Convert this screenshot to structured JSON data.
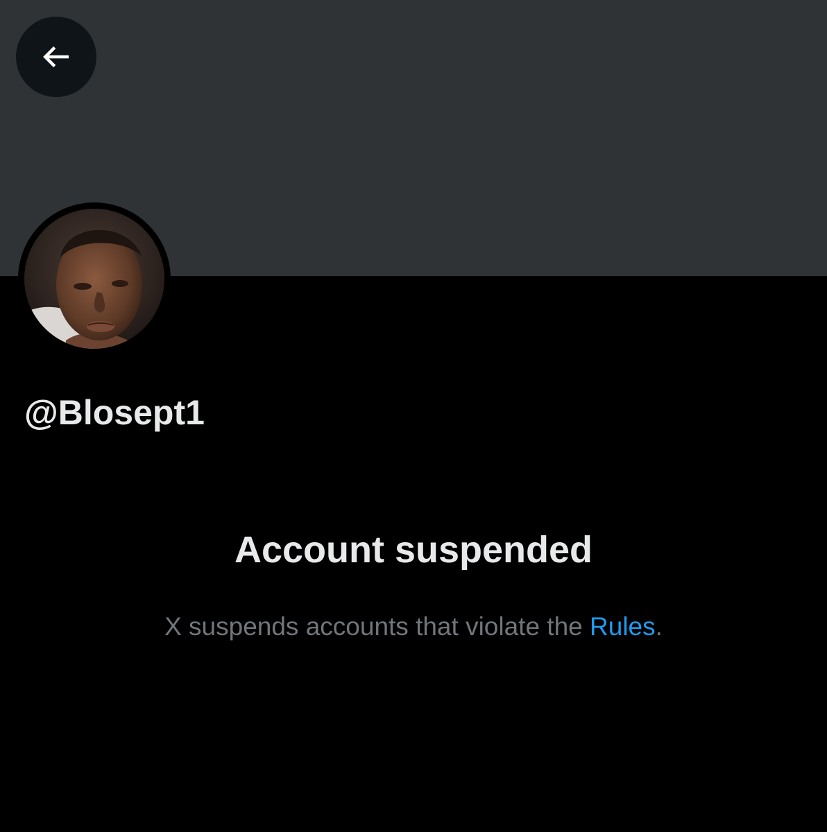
{
  "profile": {
    "handle": "@Blosept1",
    "avatar_alt": "profile-photo"
  },
  "header": {
    "back_icon": "arrow-left-icon"
  },
  "suspension": {
    "title": "Account suspended",
    "message_prefix": "X suspends accounts that violate the ",
    "rules_link_label": "Rules",
    "message_suffix": "."
  },
  "colors": {
    "background": "#000000",
    "banner": "#2f3336",
    "primary_text": "#e7e9ea",
    "secondary_text": "#71767b",
    "link": "#1d9bf0"
  }
}
